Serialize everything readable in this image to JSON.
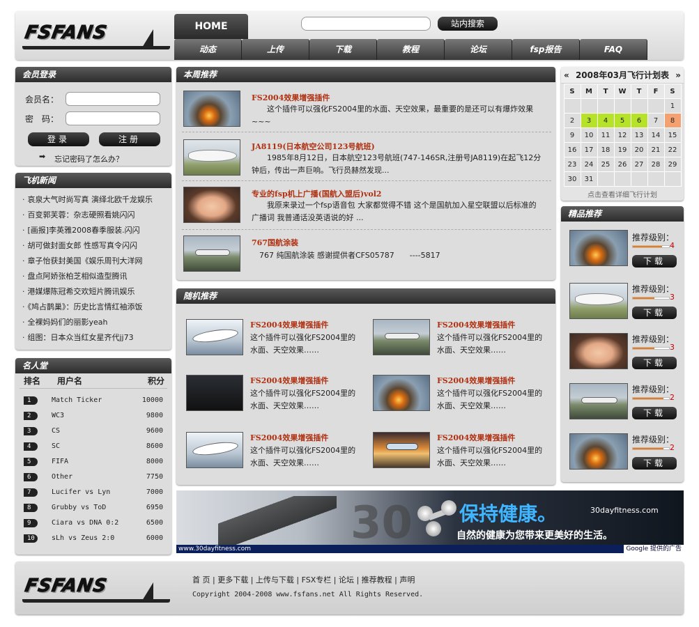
{
  "header": {
    "logo_text": "FSFANS",
    "home_tab": "HOME",
    "search_button": "站内搜索",
    "search_placeholder": "",
    "nav": [
      "动态",
      "上传",
      "下载",
      "教程",
      "论坛",
      "fsp报告",
      "FAQ"
    ]
  },
  "login": {
    "title": "会员登录",
    "username_label": "会员名：",
    "password_label": "密　码：",
    "login_button": "登录",
    "register_button": "注册",
    "forgot_link": "忘记密码了怎么办？"
  },
  "news": {
    "title": "飞机新闻",
    "items": [
      "哀泉大气时尚写真 演绎北欧千龙娱乐",
      "百变郭芙蓉：杂志硬照看姚闪闪",
      "[画报]李英雅2008春季服装.闪闪",
      "胡可做封面女郎 性感写真令闪闪",
      "章子怡获封美国《娱乐周刊大洋网",
      "盘点阿娇张柏芝相似造型腾讯",
      "港媒爆陈冠希交欢短片腾讯娱乐",
      "《鸠占鹊巢》：历史比言情红袖添饭",
      "全裸妈妈们的丽影yeah",
      "组图：日本众当红女星齐代jj73"
    ]
  },
  "ranking": {
    "title": "名人堂",
    "col_rank": "排名",
    "col_user": "用户名",
    "col_score": "积分",
    "rows": [
      {
        "rank": "1",
        "user": "Match Ticker",
        "score": "10000"
      },
      {
        "rank": "2",
        "user": "WC3",
        "score": "9800"
      },
      {
        "rank": "3",
        "user": "CS",
        "score": "9600"
      },
      {
        "rank": "4",
        "user": "SC",
        "score": "8600"
      },
      {
        "rank": "5",
        "user": "FIFA",
        "score": "8000"
      },
      {
        "rank": "6",
        "user": "Other",
        "score": "7750"
      },
      {
        "rank": "7",
        "user": "Lucifer vs Lyn",
        "score": "7000"
      },
      {
        "rank": "8",
        "user": "Grubby vs ToD",
        "score": "6950"
      },
      {
        "rank": "9",
        "user": "Ciara vs DNA 0:2",
        "score": "6500"
      },
      {
        "rank": "10",
        "user": "sLh vs Zeus 2:0",
        "score": "6000"
      }
    ]
  },
  "weekly": {
    "title": "本周推荐",
    "items": [
      {
        "title": "FS2004效果增强插件",
        "desc": "　　这个插件可以强化FS2004里的水面、天空效果，最重要的是还可以有爆炸效果~~~"
      },
      {
        "title": "JA8119(日本航空公司123号航班)",
        "desc": "　　1985年8月12日，日本航空123号航班(747-146SR,注册号JA8119)在起飞12分钟后，传出一声巨响。飞行员赫然发现..."
      },
      {
        "title": "专业的fsp机上广播(国航入盟后)vol2",
        "desc": "　　我原来录过一个fsp语音包 大家都觉得不错 这个是国航加入星空联盟以后标准的广播词 我普通话没英语说的好 ..."
      },
      {
        "title": "767国航涂装",
        "desc": "　767 纯国航涂装 感谢提供者CFS05787　　----5817"
      }
    ]
  },
  "random": {
    "title": "随机推荐",
    "items": [
      {
        "title": "FS2004效果增强插件",
        "desc": "这个插件可以强化FS2004里的水面、天空效果……"
      },
      {
        "title": "FS2004效果增强插件",
        "desc": "这个插件可以强化FS2004里的水面、天空效果……"
      },
      {
        "title": "FS2004效果增强插件",
        "desc": "这个插件可以强化FS2004里的水面、天空效果……"
      },
      {
        "title": "FS2004效果增强插件",
        "desc": "这个插件可以强化FS2004里的水面、天空效果……"
      },
      {
        "title": "FS2004效果增强插件",
        "desc": "这个插件可以强化FS2004里的水面、天空效果……"
      },
      {
        "title": "FS2004效果增强插件",
        "desc": "这个插件可以强化FS2004里的水面、天空效果……"
      }
    ]
  },
  "calendar": {
    "prev": "«",
    "next": "»",
    "title": "2008年03月飞行计划表",
    "days_of_week": [
      "S",
      "M",
      "T",
      "W",
      "T",
      "F",
      "S"
    ],
    "weeks": [
      [
        "",
        "",
        "",
        "",
        "",
        "",
        "1"
      ],
      [
        "2",
        "3",
        "4",
        "5",
        "6",
        "7",
        "8"
      ],
      [
        "9",
        "10",
        "11",
        "12",
        "13",
        "14",
        "15"
      ],
      [
        "16",
        "17",
        "18",
        "19",
        "20",
        "21",
        "22"
      ],
      [
        "23",
        "24",
        "25",
        "26",
        "27",
        "28",
        "29"
      ],
      [
        "30",
        "31",
        "",
        "",
        "",
        "",
        ""
      ]
    ],
    "highlight_green": [
      "3",
      "4",
      "5",
      "6"
    ],
    "highlight_orange": [
      "8"
    ],
    "link": "点击查看详细飞行计划"
  },
  "featured": {
    "title": "精品推荐",
    "items": [
      {
        "label": "推荐级别：",
        "level": "4",
        "button": "下载",
        "fill": 0.8
      },
      {
        "label": "推荐级别：",
        "level": "3",
        "button": "下载",
        "fill": 0.6
      },
      {
        "label": "推荐级别：",
        "level": "3",
        "button": "下载",
        "fill": 0.6
      },
      {
        "label": "推荐级别：",
        "level": "2",
        "button": "下载",
        "fill": 0.85
      },
      {
        "label": "推荐级别：",
        "level": "2",
        "button": "下载",
        "fill": 0.85
      }
    ]
  },
  "ad": {
    "headline": "保持健康。",
    "site": "30dayfitness.com",
    "tagline": "自然的健康为您带来更美好的生活。",
    "url": "www.30dayfitness.com",
    "google_label": "Google 提供的广告",
    "big_number": "30"
  },
  "footer": {
    "logo_text": "FSFANS",
    "links": [
      "首 页",
      "更多下载",
      "上传与下载",
      "FSX专栏",
      "论坛",
      "推荐教程",
      "声明"
    ],
    "copyright": "Copyright 2004-2008 www.fsfans.net All Rights Reserved."
  },
  "colors": {
    "accent_title": "#b03010",
    "rating_fill": "#f07a10",
    "calendar_green": "#b6e22a",
    "calendar_orange": "#f4a070"
  }
}
